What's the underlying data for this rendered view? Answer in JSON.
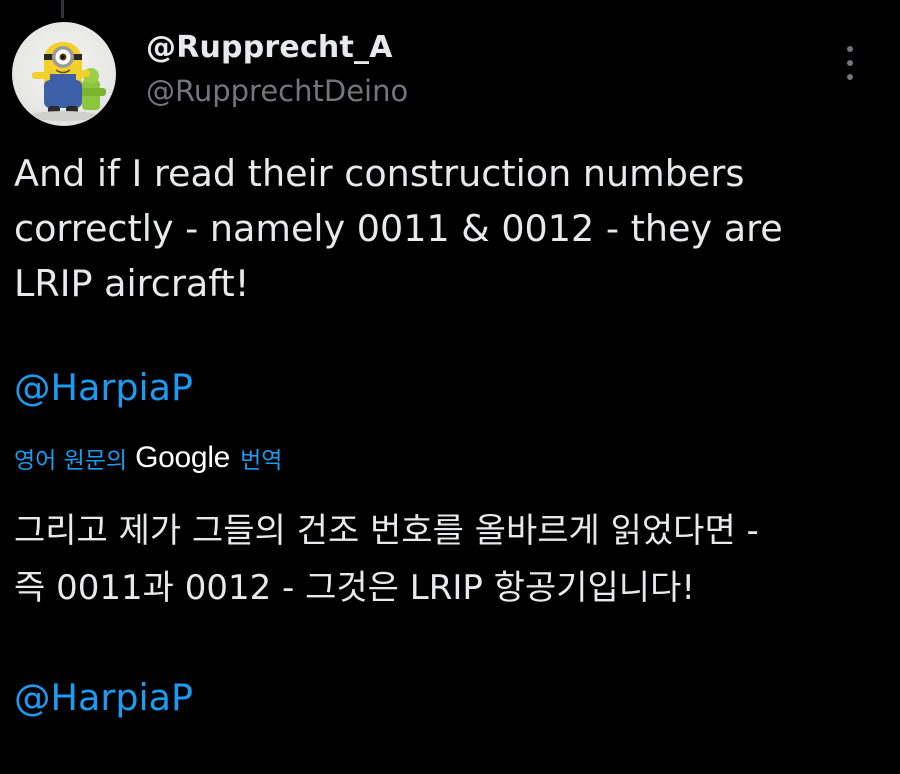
{
  "tweet": {
    "display_name": "@Rupprecht_A",
    "handle": "@RupprechtDeino",
    "text_lines": [
      "And if I read their construction numbers",
      "correctly - namely 0011 & 0012 - they are",
      "LRIP aircraft!"
    ],
    "mention": "@HarpiaP"
  },
  "translation": {
    "prefix": "영어 원문의",
    "provider": "Google",
    "suffix": "번역",
    "text_lines": [
      "그리고 제가 그들의 건조 번호를 올바르게 읽었다면 -",
      "즉 0011과 0012 - 그것은 LRIP 항공기입니다!"
    ],
    "mention": "@HarpiaP"
  },
  "icons": {
    "more": "more-vertical-icon",
    "avatar": "minion-figure-avatar"
  },
  "colors": {
    "background": "#000000",
    "text": "#e7e9ea",
    "secondary": "#71767b",
    "accent": "#1d9bf0"
  }
}
